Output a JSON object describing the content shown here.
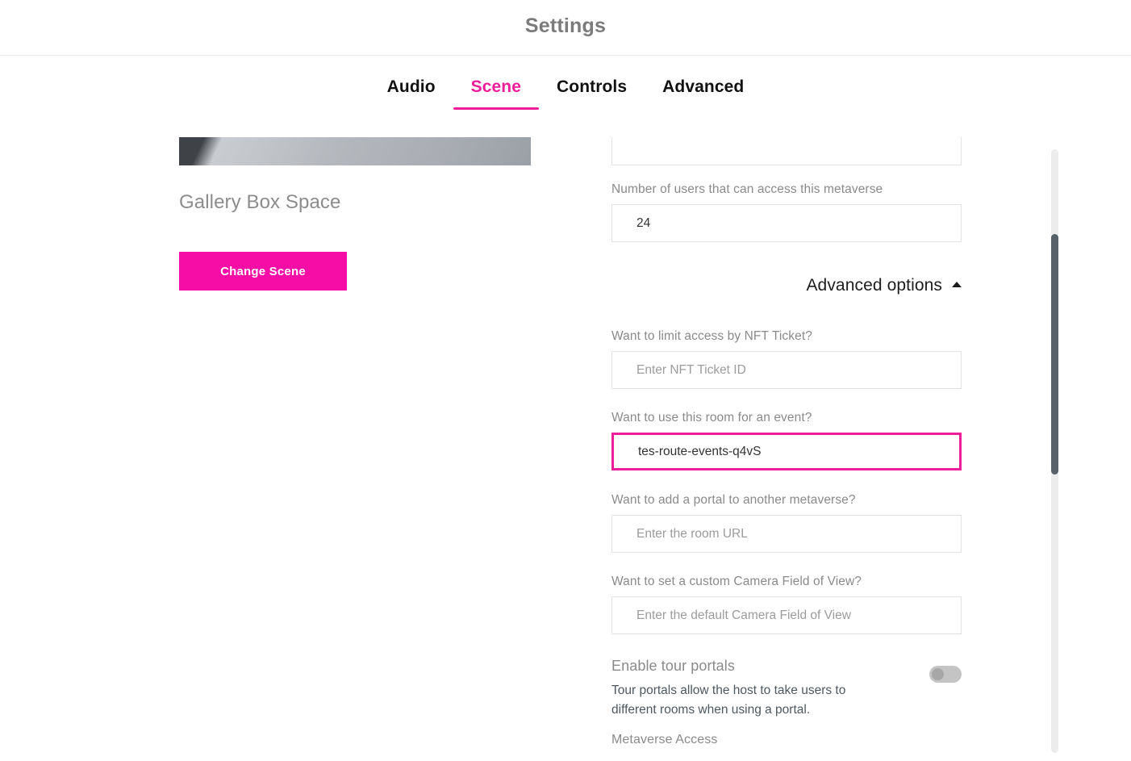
{
  "header": {
    "title": "Settings"
  },
  "tabs": [
    {
      "label": "Audio",
      "active": false
    },
    {
      "label": "Scene",
      "active": true
    },
    {
      "label": "Controls",
      "active": false
    },
    {
      "label": "Advanced",
      "active": false
    }
  ],
  "scene_panel": {
    "scene_name": "Gallery Box Space",
    "change_scene_label": "Change Scene"
  },
  "form": {
    "user_limit": {
      "label": "Number of users that can access this metaverse",
      "value": "24"
    },
    "advanced_options": {
      "label": "Advanced options",
      "expanded": true,
      "caret_icon": "caret-up-icon"
    },
    "nft_ticket": {
      "label": "Want to limit access by NFT Ticket?",
      "placeholder": "Enter NFT Ticket ID",
      "value": ""
    },
    "event_room": {
      "label": "Want to use this room for an event?",
      "placeholder": "",
      "value": "tes-route-events-q4vS",
      "focused": true
    },
    "portal": {
      "label": "Want to add a portal to another metaverse?",
      "placeholder": "Enter the room URL",
      "value": ""
    },
    "camera_fov": {
      "label": "Want to set a custom Camera Field of View?",
      "placeholder": "Enter the default Camera Field of View",
      "value": ""
    },
    "tour_portals": {
      "title": "Enable tour portals",
      "description": "Tour portals allow the host to take users to different rooms when using a portal.",
      "enabled": false
    },
    "metaverse_access": {
      "label": "Metaverse Access"
    }
  },
  "colors": {
    "accent": "#ee1d9a",
    "button": "#f50da5",
    "label_gray": "#8a8a8a",
    "scrollbar_thumb": "#586069",
    "scrollbar_track": "#ececec"
  }
}
